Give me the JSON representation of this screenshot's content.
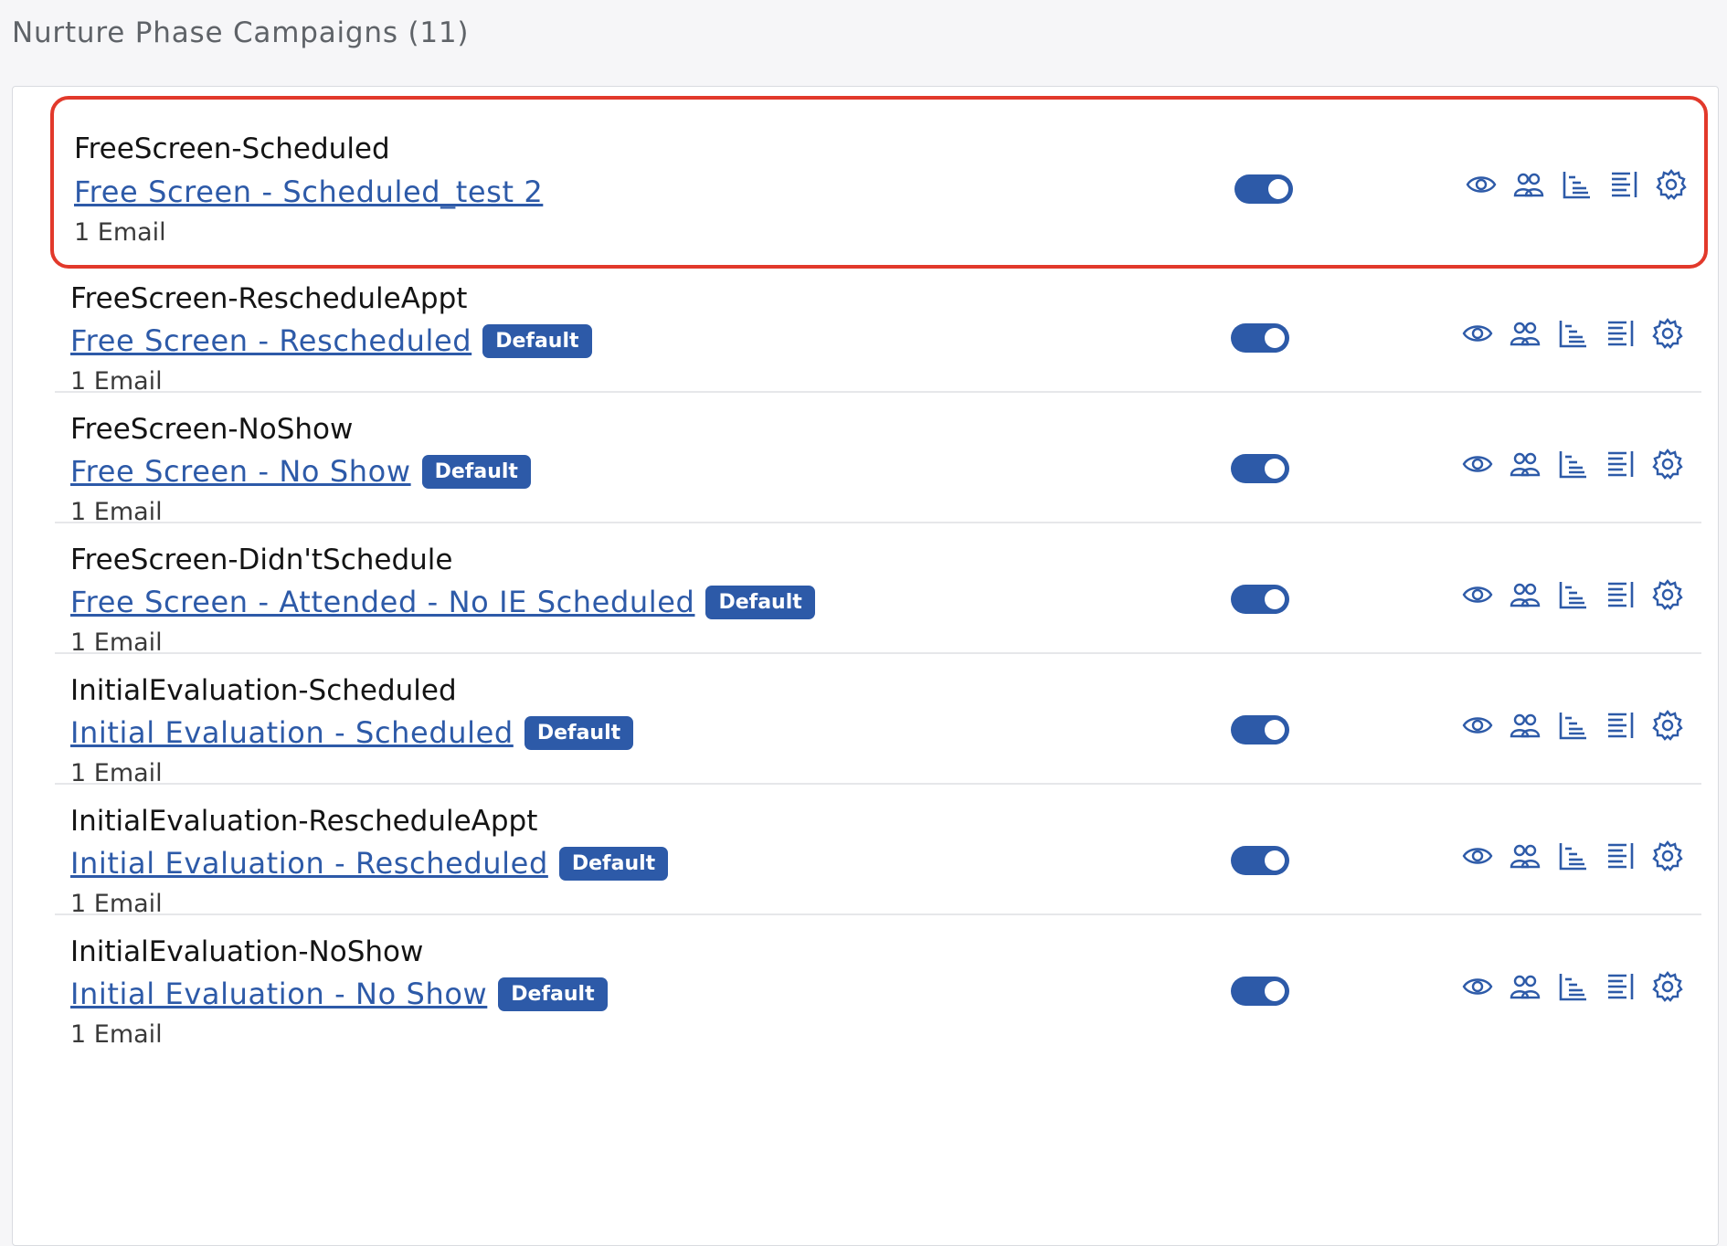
{
  "page": {
    "title": "Nurture Phase Campaigns (11)"
  },
  "colors": {
    "accent": "#2d5aa8",
    "highlight": "#e2392b"
  },
  "icons": [
    "eye-icon",
    "users-icon",
    "hierarchy-icon",
    "report-icon",
    "gear-icon"
  ],
  "campaigns": [
    {
      "name": "FreeScreen-Scheduled",
      "link": "Free Screen - Scheduled_test 2",
      "badge": "",
      "emails": "1 Email",
      "enabled": true,
      "highlighted": true
    },
    {
      "name": "FreeScreen-RescheduleAppt",
      "link": "Free Screen - Rescheduled",
      "badge": "Default",
      "emails": "1 Email",
      "enabled": true,
      "highlighted": false
    },
    {
      "name": "FreeScreen-NoShow",
      "link": "Free Screen - No Show",
      "badge": "Default",
      "emails": "1 Email",
      "enabled": true,
      "highlighted": false
    },
    {
      "name": "FreeScreen-Didn'tSchedule",
      "link": "Free Screen - Attended - No IE Scheduled",
      "badge": "Default",
      "emails": "1 Email",
      "enabled": true,
      "highlighted": false
    },
    {
      "name": "InitialEvaluation-Scheduled",
      "link": "Initial Evaluation - Scheduled",
      "badge": "Default",
      "emails": "1 Email",
      "enabled": true,
      "highlighted": false
    },
    {
      "name": "InitialEvaluation-RescheduleAppt",
      "link": "Initial Evaluation - Rescheduled",
      "badge": "Default",
      "emails": "1 Email",
      "enabled": true,
      "highlighted": false
    },
    {
      "name": "InitialEvaluation-NoShow",
      "link": "Initial Evaluation - No Show",
      "badge": "Default",
      "emails": "1 Email",
      "enabled": true,
      "highlighted": false
    }
  ]
}
